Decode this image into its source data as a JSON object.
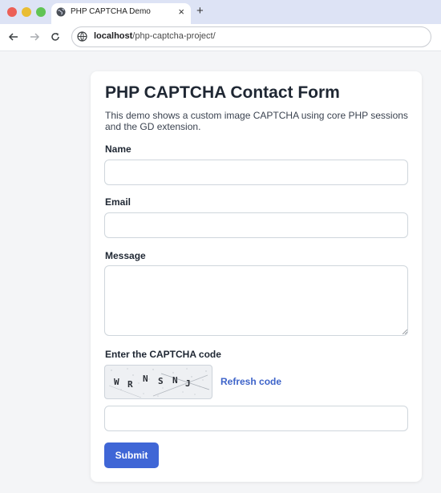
{
  "browser": {
    "tab_title": "PHP CAPTCHA Demo",
    "tab_close": "×",
    "new_tab": "+",
    "url_host": "localhost",
    "url_path": "/php-captcha-project/"
  },
  "form": {
    "title": "PHP CAPTCHA Contact Form",
    "description": "This demo shows a custom image CAPTCHA using core PHP sessions and the GD extension.",
    "name_label": "Name",
    "name_value": "",
    "email_label": "Email",
    "email_value": "",
    "message_label": "Message",
    "message_value": "",
    "captcha_label": "Enter the CAPTCHA code",
    "captcha_chars": [
      "W",
      "R",
      "N",
      "S",
      "N",
      "J"
    ],
    "refresh_label": "Refresh code",
    "captcha_value": "",
    "submit_label": "Submit"
  },
  "colors": {
    "accent": "#3f66d6",
    "link": "#3d63c9",
    "chrome": "#dde3f5"
  }
}
